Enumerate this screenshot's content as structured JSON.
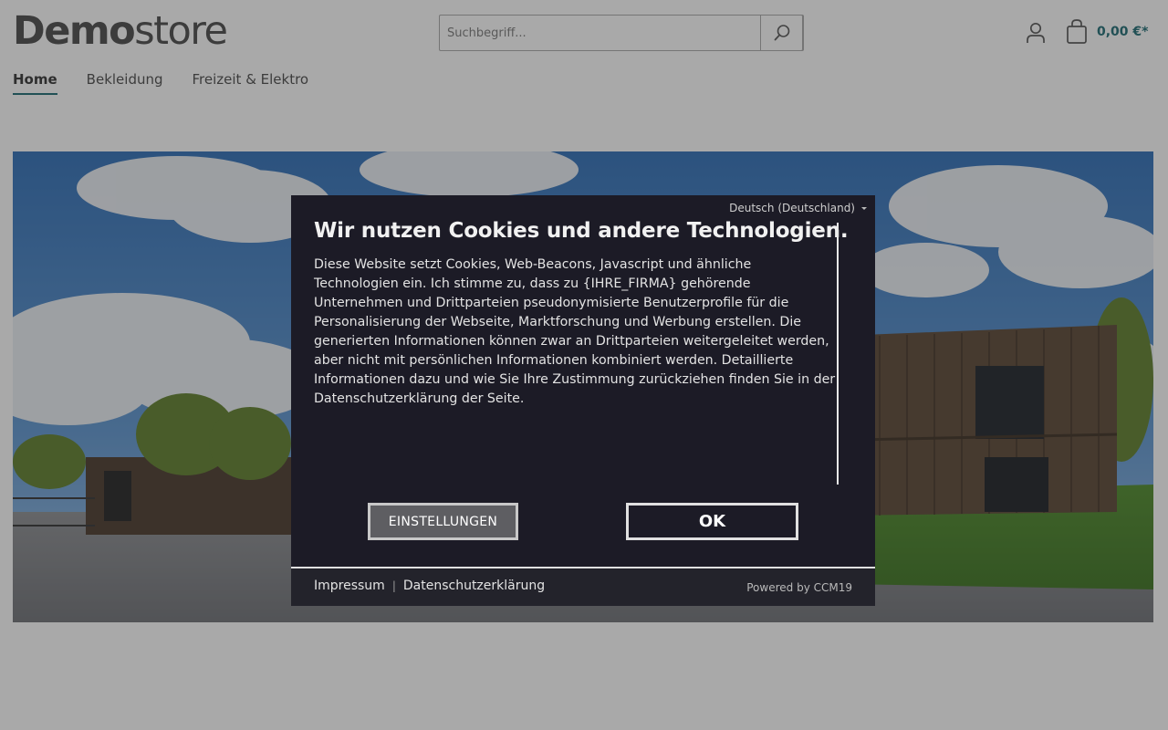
{
  "header": {
    "logo_bold": "Demo",
    "logo_light": "store",
    "search_placeholder": "Suchbegriff...",
    "cart_total": "0,00 €*"
  },
  "nav": {
    "items": [
      {
        "label": "Home",
        "active": true
      },
      {
        "label": "Bekleidung",
        "active": false
      },
      {
        "label": "Freizeit & Elektro",
        "active": false
      }
    ]
  },
  "cookie_dialog": {
    "language": "Deutsch (Deutschland)",
    "title": "Wir nutzen Cookies und andere Technologien.",
    "body": "Diese Website setzt Cookies, Web-Beacons, Javascript und ähnliche Technologien ein. Ich stimme zu, dass zu {IHRE_FIRMA} gehörende Unternehmen und Drittparteien pseudonymisierte Benutzerprofile für die Personalisierung der Webseite, Marktforschung und Werbung erstellen. Die generierten Informationen können zwar an Drittparteien weitergeleitet werden, aber nicht mit persönlichen Informationen kombiniert werden. Detaillierte Informationen dazu und wie Sie Ihre Zustimmung zurückziehen finden Sie in der Datenschutzerklärung der Seite.",
    "settings_label": "EINSTELLUNGEN",
    "ok_label": "OK",
    "footer_links": [
      "Impressum",
      "Datenschutzerklärung"
    ],
    "powered_by": "Powered by CCM19"
  },
  "colors": {
    "accent": "#1d6b73",
    "dialog_bg": "#1c1b26",
    "overlay": "rgba(40,40,40,0.4)"
  }
}
